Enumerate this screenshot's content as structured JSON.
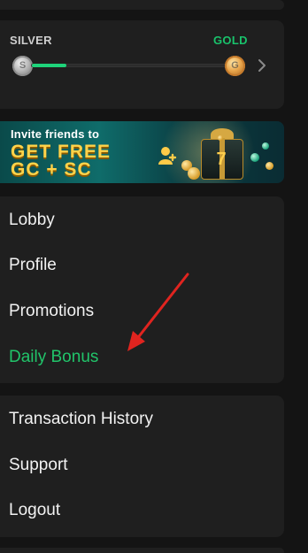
{
  "level": {
    "current_tier": "SILVER",
    "next_tier": "GOLD",
    "progress_percent": 18
  },
  "banner": {
    "line1": "Invite friends to",
    "line2": "GET FREE",
    "line3": "GC + SC",
    "box_digit": "7"
  },
  "menu_group_1": [
    {
      "label": "Lobby",
      "active": false
    },
    {
      "label": "Profile",
      "active": false
    },
    {
      "label": "Promotions",
      "active": false
    },
    {
      "label": "Daily Bonus",
      "active": true
    }
  ],
  "menu_group_2": [
    {
      "label": "Transaction History"
    },
    {
      "label": "Support"
    },
    {
      "label": "Logout"
    }
  ],
  "colors": {
    "accent_green": "#21c46a",
    "annotation_red": "#e0241f"
  },
  "icons": {
    "next_tier": "chevron-right-icon",
    "silver_badge": "silver-medal-icon",
    "gold_badge": "gold-medal-icon",
    "annotation": "red-arrow-icon"
  }
}
